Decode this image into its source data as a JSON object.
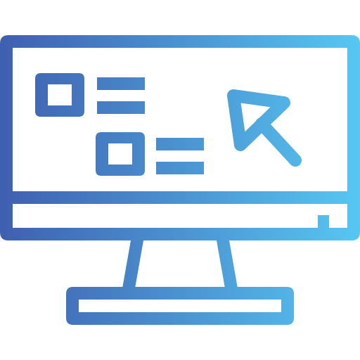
{
  "icon": {
    "name": "computer-monitor-icon",
    "gradient": {
      "start": "#3f5fb0",
      "end": "#56c7f2"
    },
    "background": "#ffffff",
    "parts": [
      "monitor-frame-icon",
      "screen-icon",
      "checkbox-icon",
      "list-lines-icon",
      "cursor-arrow-icon",
      "monitor-stand-icon"
    ]
  }
}
